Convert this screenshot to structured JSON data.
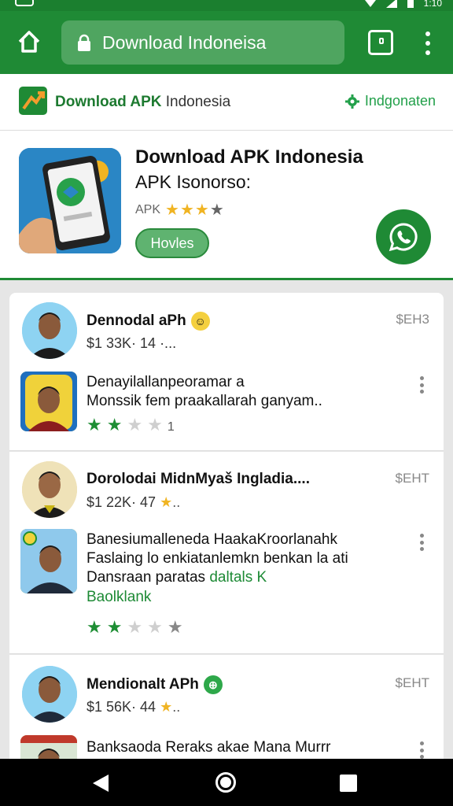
{
  "status_bar": {
    "time": "1:10"
  },
  "browser": {
    "url": "Download Indoneisa",
    "icons": {
      "home": "home-icon",
      "lock": "lock-icon",
      "tabs": "tabs-icon",
      "menu": "more-vert-icon"
    }
  },
  "site_header": {
    "name_bold": "Download APK",
    "name_regular": " Indonesia",
    "link_label": "Indgonaten",
    "colors": {
      "brand_green": "#1f8a35",
      "link_green": "#22a04a"
    }
  },
  "app": {
    "title": "Download APK Indonesia",
    "subtitle": "APK Isonorso:",
    "meta_label": "APK",
    "stars": "★★★",
    "stars_empty": "★",
    "install_label": "Hovles",
    "whatsapp_icon": "whatsapp-icon"
  },
  "items": [
    {
      "title": "Dennodal aPh",
      "sub": "$1 33K· 14 ·...",
      "price": "$EH3",
      "text_line1": "Denayilallanpeoramar a",
      "text_line2": "Monssik fem praakallarah ganyam..",
      "rating_text": "1"
    },
    {
      "title": "Dorolodai MidnMyaš Ingladia....",
      "sub": "$1 22K· 47",
      "price": "$EHT",
      "text_line1": "Banesiumalleneda HaakaKroorlanahk",
      "text_line2": "Faslaing lo enkiatanlemkn benkan la ati",
      "text_line3_a": "Dansraan paratas ",
      "text_line3_b": "daltals K",
      "more_label": "Baolklank"
    },
    {
      "title": "Mendionalt APh",
      "sub": "$1 56K· 44",
      "price": "$EHT",
      "text_line1": "Banksaoda Reraks akae Mana Murrr"
    }
  ]
}
